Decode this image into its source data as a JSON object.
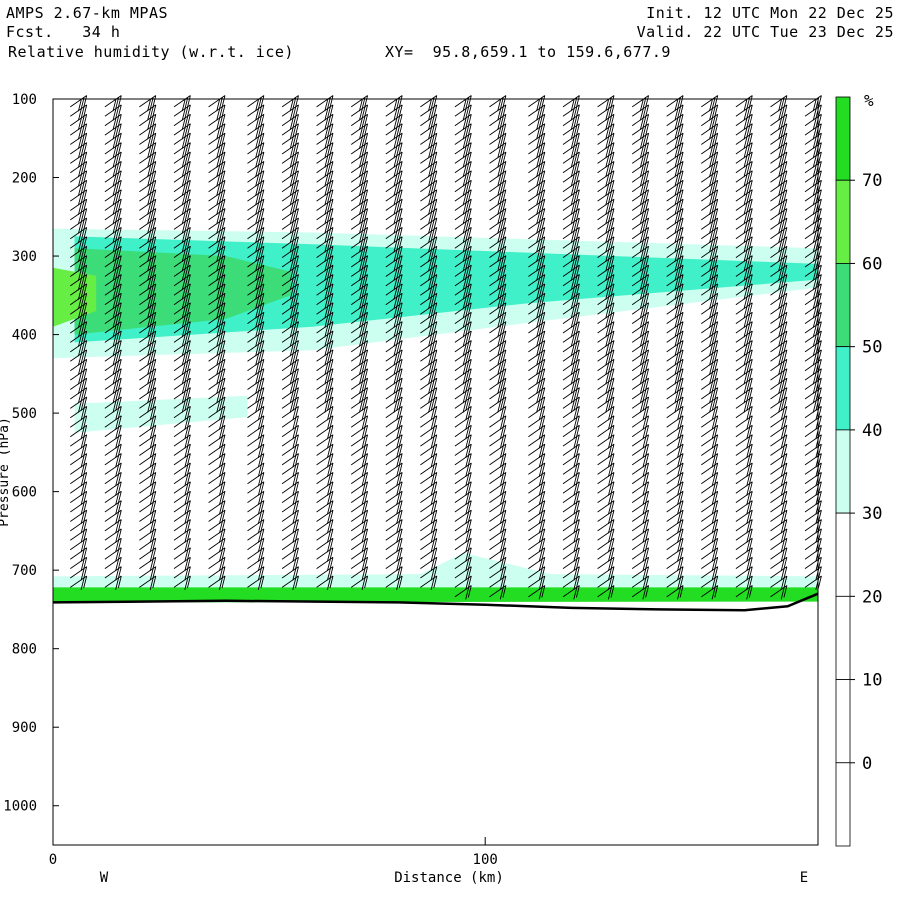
{
  "header": {
    "model": "AMPS 2.67-km MPAS",
    "forecast": "Fcst.   34 h",
    "field": "Relative humidity (w.r.t. ice)",
    "xy": "XY=  95.8,659.1 to 159.6,677.9",
    "init": "Init. 12 UTC Mon 22 Dec 25",
    "valid": "Valid. 22 UTC Tue 23 Dec 25"
  },
  "chart_data": {
    "type": "area",
    "xlabel": "Distance (km)",
    "ylabel": "Pressure (hPa)",
    "xlim": [
      0,
      177
    ],
    "ylim": [
      1050,
      100
    ],
    "y_ticks": [
      "100",
      "200",
      "300",
      "400",
      "500",
      "600",
      "700",
      "800",
      "900",
      "1000"
    ],
    "x_ticks": [
      "0",
      "100"
    ],
    "x_end_labels": {
      "west": "W",
      "east": "E"
    },
    "colorbar": {
      "unit": "%",
      "levels": [
        0,
        10,
        20,
        30,
        40,
        50,
        60,
        70
      ],
      "labels": [
        "70",
        "60",
        "50",
        "40",
        "30",
        "20",
        "10",
        "0"
      ],
      "colors": {
        "30-40": "#ccfff0",
        "40-50": "#3ff0c8",
        "50-60": "#3cdc78",
        "60-70": "#66ee44",
        "70-80": "#22dd22"
      }
    },
    "terrain_pressure_hpa": [
      {
        "x": 0,
        "p": 741
      },
      {
        "x": 40,
        "p": 739
      },
      {
        "x": 80,
        "p": 741
      },
      {
        "x": 100,
        "p": 744
      },
      {
        "x": 120,
        "p": 748
      },
      {
        "x": 140,
        "p": 750
      },
      {
        "x": 160,
        "p": 751
      },
      {
        "x": 170,
        "p": 746
      },
      {
        "x": 177,
        "p": 730
      }
    ],
    "rh_regions": [
      {
        "band": "30-40",
        "upper": [
          {
            "x": 0,
            "p": 265
          },
          {
            "x": 60,
            "p": 270
          },
          {
            "x": 130,
            "p": 282
          },
          {
            "x": 177,
            "p": 290
          }
        ],
        "lower": [
          {
            "x": 0,
            "p": 430
          },
          {
            "x": 60,
            "p": 420
          },
          {
            "x": 110,
            "p": 385
          },
          {
            "x": 177,
            "p": 340
          }
        ]
      },
      {
        "band": "40-50",
        "upper": [
          {
            "x": 5,
            "p": 275
          },
          {
            "x": 60,
            "p": 285
          },
          {
            "x": 130,
            "p": 300
          },
          {
            "x": 177,
            "p": 310
          }
        ],
        "lower": [
          {
            "x": 5,
            "p": 410
          },
          {
            "x": 60,
            "p": 390
          },
          {
            "x": 110,
            "p": 360
          },
          {
            "x": 177,
            "p": 330
          }
        ]
      },
      {
        "band": "50-60",
        "upper": [
          {
            "x": 5,
            "p": 290
          },
          {
            "x": 40,
            "p": 300
          },
          {
            "x": 55,
            "p": 320
          }
        ],
        "lower": [
          {
            "x": 5,
            "p": 400
          },
          {
            "x": 40,
            "p": 380
          },
          {
            "x": 55,
            "p": 350
          }
        ]
      },
      {
        "band": "60-70",
        "upper": [
          {
            "x": 0,
            "p": 315
          },
          {
            "x": 10,
            "p": 325
          }
        ],
        "lower": [
          {
            "x": 0,
            "p": 390
          },
          {
            "x": 10,
            "p": 370
          }
        ]
      },
      {
        "band": "30-40",
        "upper": [
          {
            "x": 5,
            "p": 488
          },
          {
            "x": 45,
            "p": 478
          }
        ],
        "lower": [
          {
            "x": 5,
            "p": 525
          },
          {
            "x": 45,
            "p": 505
          }
        ]
      },
      {
        "band": "30-40",
        "upper": [
          {
            "x": 0,
            "p": 708
          },
          {
            "x": 85,
            "p": 705
          },
          {
            "x": 95,
            "p": 678
          },
          {
            "x": 115,
            "p": 705
          },
          {
            "x": 177,
            "p": 708
          }
        ],
        "lower": [
          {
            "x": 0,
            "p": 735
          },
          {
            "x": 177,
            "p": 730
          }
        ]
      },
      {
        "band": "70-80",
        "upper": [
          {
            "x": 0,
            "p": 722
          },
          {
            "x": 177,
            "p": 722
          }
        ],
        "lower": [
          {
            "x": 0,
            "p": 741
          },
          {
            "x": 177,
            "p": 740
          }
        ]
      }
    ],
    "wind_barb_columns_km": [
      4,
      12,
      20,
      28,
      36,
      45,
      53,
      61,
      69,
      77,
      85,
      93,
      101,
      110,
      118,
      126,
      134,
      142,
      150,
      158,
      166,
      174
    ]
  }
}
